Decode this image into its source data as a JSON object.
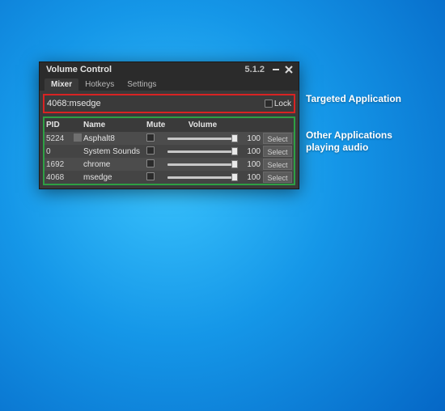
{
  "window": {
    "title": "Volume Control",
    "version": "5.1.2"
  },
  "tabs": [
    "Mixer",
    "Hotkeys",
    "Settings"
  ],
  "active_tab": 0,
  "target": {
    "value": "4068:msedge",
    "lock_label": "Lock",
    "locked": false
  },
  "headers": {
    "pid": "PID",
    "name": "Name",
    "mute": "Mute",
    "volume": "Volume"
  },
  "rows": [
    {
      "pid": "5224",
      "has_icon": true,
      "name": "Asphalt8",
      "muted": false,
      "volume": 100,
      "select_label": "Select"
    },
    {
      "pid": "0",
      "has_icon": false,
      "name": "System Sounds",
      "muted": false,
      "volume": 100,
      "select_label": "Select"
    },
    {
      "pid": "1692",
      "has_icon": false,
      "name": "chrome",
      "muted": false,
      "volume": 100,
      "select_label": "Select"
    },
    {
      "pid": "4068",
      "has_icon": false,
      "name": "msedge",
      "muted": false,
      "volume": 100,
      "select_label": "Select"
    }
  ],
  "annotations": {
    "target": "Targeted Application",
    "list1": "Other Applications",
    "list2": "playing audio"
  }
}
